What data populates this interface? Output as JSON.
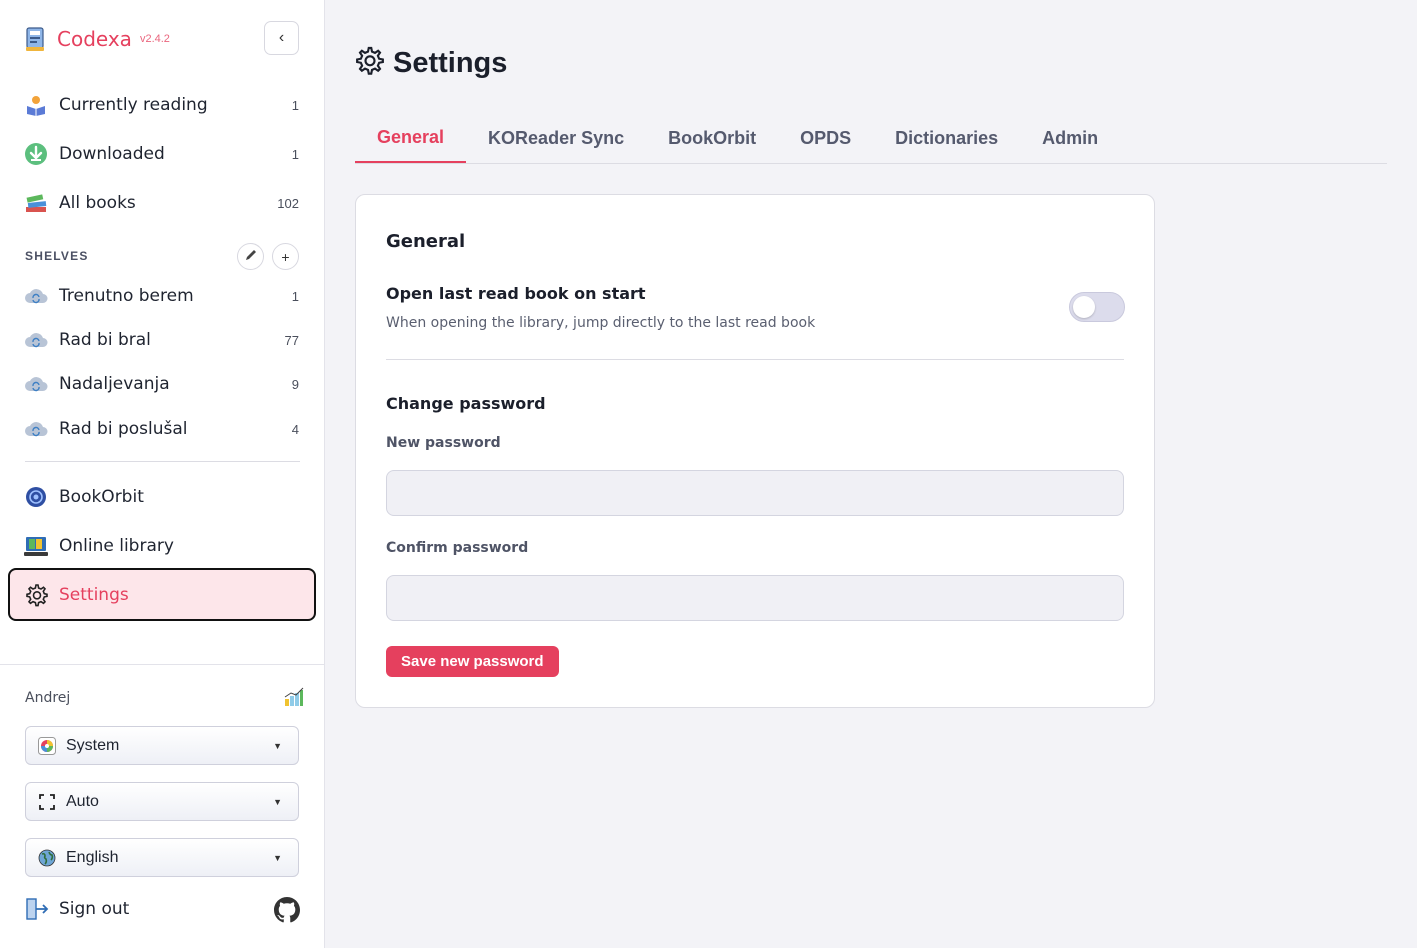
{
  "app": {
    "name": "Codexa",
    "version": "v2.4.2"
  },
  "sidebar": {
    "library": [
      {
        "label": "Currently reading",
        "count": "1",
        "icon": "reader-icon"
      },
      {
        "label": "Downloaded",
        "count": "1",
        "icon": "download-icon"
      },
      {
        "label": "All books",
        "count": "102",
        "icon": "books-icon"
      }
    ],
    "shelves_title": "SHELVES",
    "shelves": [
      {
        "label": "Trenutno berem",
        "count": "1",
        "icon": "cloud-sync-icon"
      },
      {
        "label": "Rad bi bral",
        "count": "77",
        "icon": "cloud-sync-icon"
      },
      {
        "label": "Nadaljevanja",
        "count": "9",
        "icon": "cloud-sync-icon"
      },
      {
        "label": "Rad bi poslušal",
        "count": "4",
        "icon": "cloud-sync-icon"
      }
    ],
    "services": [
      {
        "label": "BookOrbit",
        "icon": "orbit-icon"
      },
      {
        "label": "Online library",
        "icon": "online-library-icon"
      },
      {
        "label": "Settings",
        "icon": "gear-icon",
        "active": true
      }
    ],
    "user": {
      "name": "Andrej",
      "theme": "System",
      "layout": "Auto",
      "language": "English",
      "signout": "Sign out"
    }
  },
  "main": {
    "title": "Settings",
    "tabs": [
      {
        "label": "General",
        "active": true
      },
      {
        "label": "KOReader Sync"
      },
      {
        "label": "BookOrbit"
      },
      {
        "label": "OPDS"
      },
      {
        "label": "Dictionaries"
      },
      {
        "label": "Admin"
      }
    ],
    "card": {
      "title": "General",
      "open_last": {
        "label": "Open last read book on start",
        "description": "When opening the library, jump directly to the last read book",
        "enabled": false
      },
      "password": {
        "title": "Change password",
        "new_label": "New password",
        "new_value": "",
        "confirm_label": "Confirm password",
        "confirm_value": "",
        "save_label": "Save new password"
      }
    }
  },
  "colors": {
    "accent": "#e5405e",
    "active_bg": "#fde6ea"
  }
}
